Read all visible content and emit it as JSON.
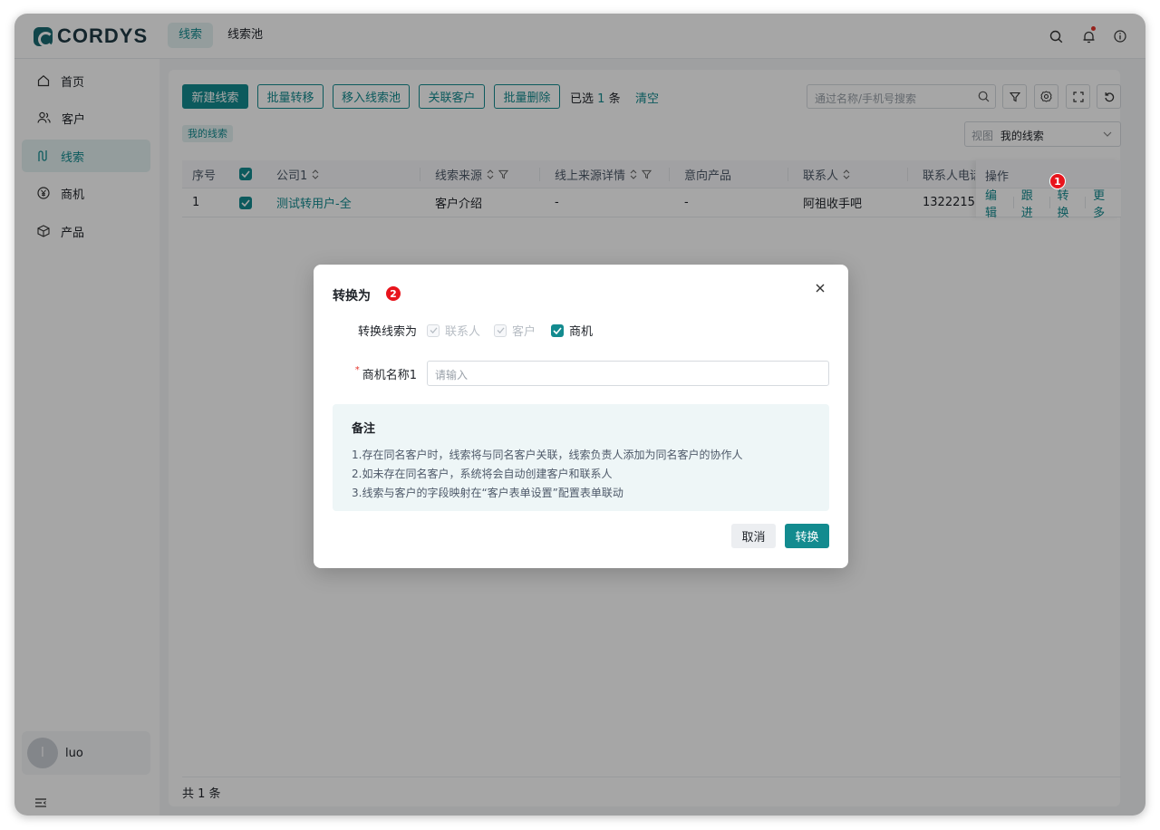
{
  "app": {
    "brand": "CORDYS"
  },
  "topbar": {
    "tabs": [
      "线索",
      "线索池"
    ]
  },
  "sidebar": {
    "items": [
      "首页",
      "客户",
      "线索",
      "商机",
      "产品"
    ],
    "user_initial": "l",
    "user_name": "luo"
  },
  "toolbar": {
    "buttons": [
      "新建线索",
      "批量转移",
      "移入线索池",
      "关联客户",
      "批量删除"
    ],
    "selected_prefix": "已选",
    "selected_count": "1",
    "selected_suffix": "条",
    "clear_label": "清空",
    "search_placeholder": "通过名称/手机号搜索"
  },
  "filter_chip": "我的线索",
  "view_select": {
    "label": "视图",
    "value": "我的线索"
  },
  "table": {
    "columns": [
      "序号",
      "公司1",
      "线索来源",
      "线上来源详情",
      "意向产品",
      "联系人",
      "联系人电话",
      "操作"
    ],
    "rows": [
      {
        "index": "1",
        "company": "测试转用户-全",
        "source": "客户介绍",
        "online_detail": "-",
        "product": "-",
        "contact": "阿祖收手吧",
        "phone": "1322215"
      }
    ],
    "row_actions": [
      "编辑",
      "跟进",
      "转换",
      "更多"
    ]
  },
  "footer": {
    "total": "共 1 条"
  },
  "badges": {
    "step1": "1",
    "step2": "2"
  },
  "modal": {
    "title": "转换为",
    "convert_label": "转换线索为",
    "options": [
      {
        "label": "联系人",
        "state": "disabled-checked"
      },
      {
        "label": "客户",
        "state": "disabled-checked"
      },
      {
        "label": "商机",
        "state": "checked"
      }
    ],
    "name_label": "商机名称1",
    "name_placeholder": "请输入",
    "note_title": "备注",
    "notes": [
      "1.存在同名客户时，线索将与同名客户关联，线索负责人添加为同名客户的协作人",
      "2.如未存在同名客户，系统将会自动创建客户和联系人",
      "3.线索与客户的字段映射在“客户表单设置”配置表单联动"
    ],
    "cancel_label": "取消",
    "confirm_label": "转换"
  },
  "colors": {
    "accent": "#138b8f",
    "badge": "#e8141c"
  }
}
